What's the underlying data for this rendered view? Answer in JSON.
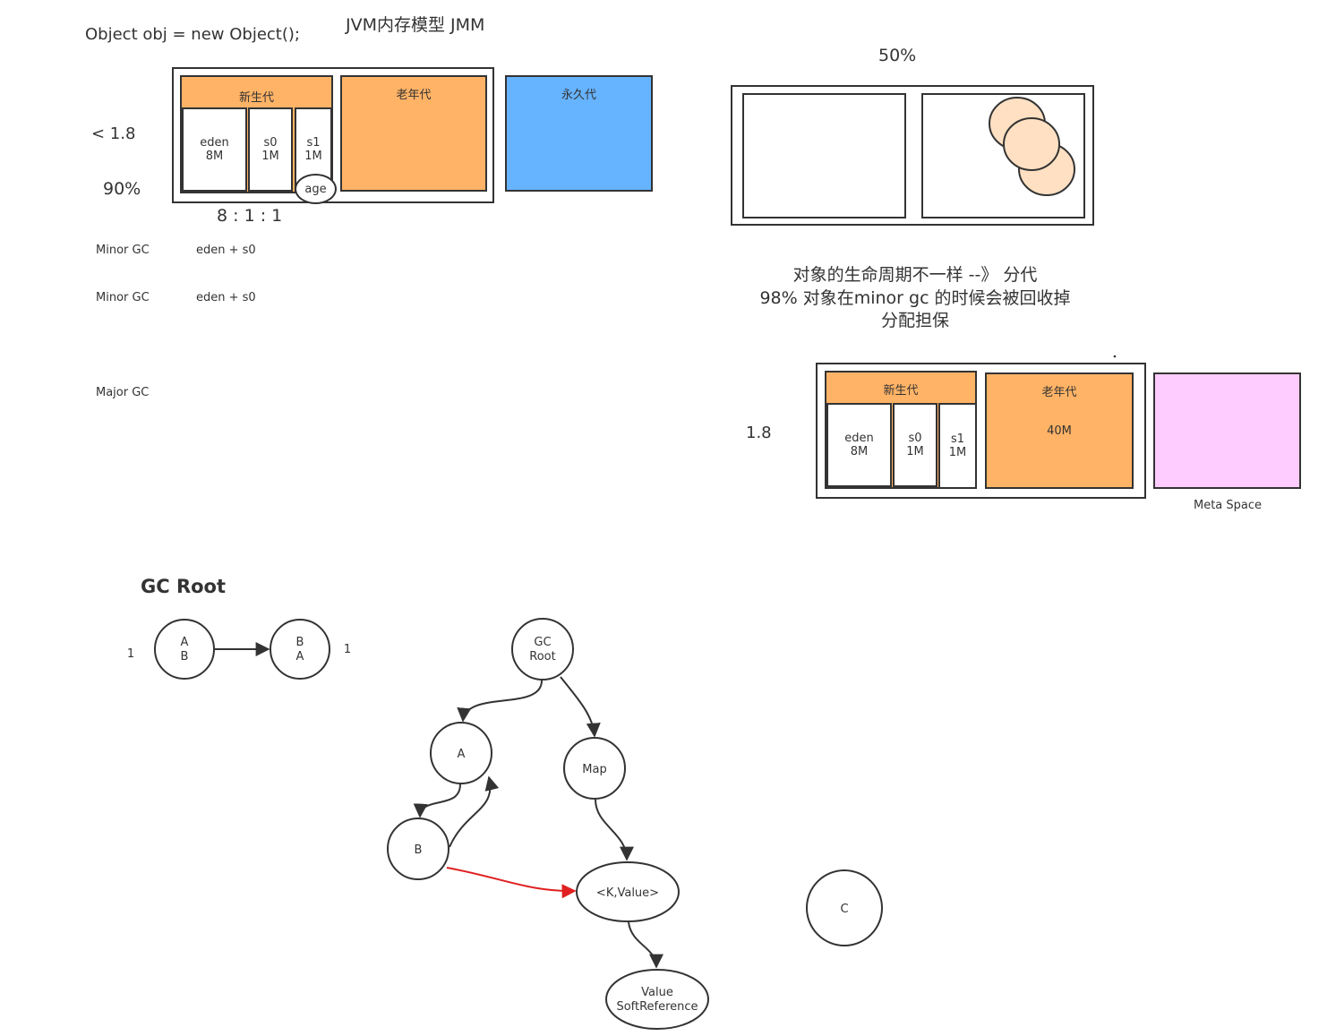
{
  "title": "JVM内存模型 JMM",
  "code_line": "Object obj = new Object();",
  "left_memory": {
    "version_label": "< 1.8",
    "percent_label": "90%",
    "ratio_label": "8 : 1 : 1",
    "young_gen": "新生代",
    "old_gen": "老年代",
    "perm_gen": "永久代",
    "eden": "eden\n8M",
    "s0": "s0\n1M",
    "s1": "s1\n1M",
    "age": "age"
  },
  "gc_notes": [
    {
      "name": "Minor GC",
      "detail": "eden + s0"
    },
    {
      "name": "Minor GC",
      "detail": "eden + s0"
    },
    {
      "name": "Major GC",
      "detail": ""
    }
  ],
  "right_top": {
    "percent_label": "50%",
    "notes": [
      "对象的生命周期不一样 --》 分代",
      "98% 对象在minor gc 的时候会被回收掉",
      "分配担保"
    ]
  },
  "right_memory": {
    "version_label": "1.8",
    "young_gen": "新生代",
    "old_gen": "老年代",
    "old_size": "40M",
    "eden": "eden\n8M",
    "s0": "s0\n1M",
    "s1": "s1\n1M",
    "meta_space": "Meta Space"
  },
  "gc_root": {
    "heading": "GC Root",
    "cycle": {
      "left_count": "1",
      "left_node": "A\nB",
      "right_node": "B\nA",
      "right_count": "1"
    },
    "nodes": {
      "root": "GC\nRoot",
      "a": "A",
      "b": "B",
      "map": "Map",
      "kv": "<K,Value>",
      "value": "Value\nSoftReference",
      "c": "C"
    }
  },
  "colors": {
    "orange": "#ffb366",
    "blue": "#66b3ff",
    "pink": "#ffccff",
    "peach": "#ffe0c2",
    "red_arrow": "#e02020",
    "stroke": "#333333"
  }
}
